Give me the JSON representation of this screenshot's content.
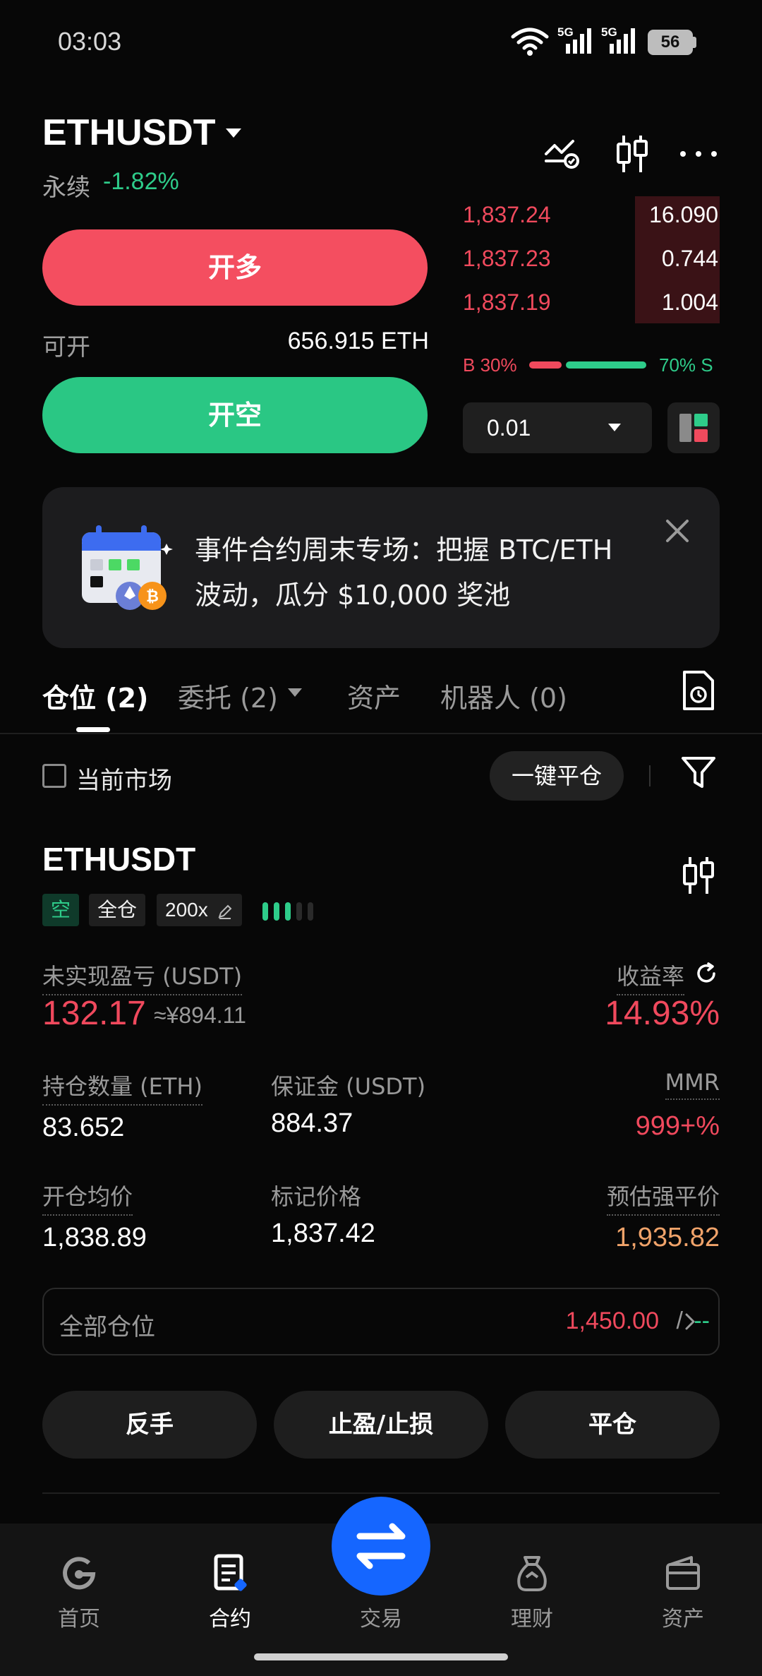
{
  "status_bar": {
    "time": "03:03",
    "battery": "56",
    "signal1": "5G",
    "signal2": "5G"
  },
  "header": {
    "pair": "ETHUSDT",
    "type": "永续",
    "change": "-1.82%"
  },
  "order_form": {
    "long_label": "开多",
    "avail_label": "可开",
    "avail_value": "656.915 ETH",
    "short_label": "开空"
  },
  "orderbook": {
    "asks": [
      {
        "price": "1,837.24",
        "qty": "16.090",
        "depth": 0.2
      },
      {
        "price": "1,837.23",
        "qty": "0.744",
        "depth": 0.2
      },
      {
        "price": "1,837.19",
        "qty": "1.004",
        "depth": 0.2
      }
    ],
    "buy_ratio": "B 30%",
    "sell_ratio": "70% S",
    "buy_ratio_value": 30,
    "qty_step": "0.01"
  },
  "banner": {
    "line1": "事件合约周末专场：把握 BTC/ETH",
    "line2": "波动，瓜分 $10,000 奖池"
  },
  "tabs": [
    {
      "label": "仓位 (2)"
    },
    {
      "label": "委托 (2)"
    },
    {
      "label": "资产"
    },
    {
      "label": "机器人 (0)"
    }
  ],
  "filter": {
    "current_market": "当前市场",
    "close_all": "一键平仓"
  },
  "position": {
    "symbol": "ETHUSDT",
    "side": "空",
    "margin_mode": "全仓",
    "leverage": "200x",
    "risk_level": 3,
    "upnl_label": "未实现盈亏 (USDT)",
    "upnl": "132.17",
    "upnl_cny": "≈¥894.11",
    "roe_label": "收益率",
    "roe": "14.93%",
    "size_label": "持仓数量 (ETH)",
    "size": "83.652",
    "margin_label": "保证金 (USDT)",
    "margin": "884.37",
    "mmr_label": "MMR",
    "mmr": "999+%",
    "entry_label": "开仓均价",
    "entry": "1,838.89",
    "mark_label": "标记价格",
    "mark": "1,837.42",
    "liq_label": "预估强平价",
    "liq": "1,935.82",
    "all_positions_label": "全部仓位",
    "all_positions_red": "1,450.00",
    "all_positions_slash": "/",
    "all_positions_green": "--"
  },
  "actions": {
    "reverse": "反手",
    "tpsl": "止盈/止损",
    "close": "平仓"
  },
  "nav": [
    {
      "label": "首页",
      "icon": "home-icon"
    },
    {
      "label": "合约",
      "icon": "futures-icon"
    },
    {
      "label": "交易",
      "icon": "trade-icon"
    },
    {
      "label": "理财",
      "icon": "earn-icon"
    },
    {
      "label": "资产",
      "icon": "wallet-icon"
    }
  ],
  "colors": {
    "red": "#f0495d",
    "green": "#2ecc8a",
    "accent": "#1566ff",
    "orange": "#f0a36a"
  }
}
